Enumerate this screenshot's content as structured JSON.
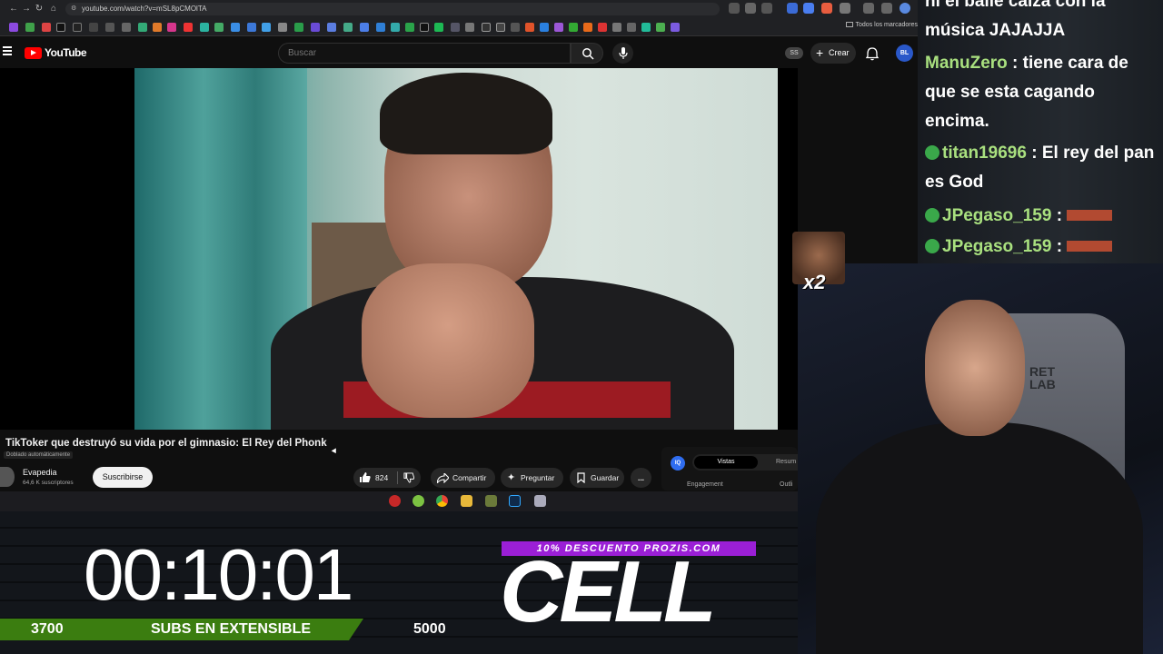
{
  "browser": {
    "url": "youtube.com/watch?v=mSL8pCMOlTA",
    "all_bookmarks": "Todos los marcadores"
  },
  "youtube": {
    "logo_text": "YouTube",
    "search_placeholder": "Buscar",
    "ss_badge": "SS",
    "create_label": "Crear",
    "avatar_text": "BL"
  },
  "video": {
    "title": "TikToker que destruyó su vida por el gimnasio: El Rey del Phonk",
    "dub_label": "Doblado automáticamente",
    "channel_name": "Evapedia",
    "subscribers": "64,6 K suscriptores",
    "subscribe_label": "Suscribirse",
    "likes": "824",
    "share_label": "Compartir",
    "ask_label": "Preguntar",
    "save_label": "Guardar",
    "more_label": "..."
  },
  "side_panel": {
    "logo": "IQ",
    "tab_active": "Vistas",
    "tab_other": "Resum",
    "engagement": "Engagement",
    "outline": "Outli"
  },
  "overlay": {
    "timer": "00:10:01",
    "goal_current": "3700",
    "goal_label": "SUBS EN EXTENSIBLE",
    "goal_target": "5000",
    "goal_progress_fraction": 0.74,
    "promo": "10% DESCUENTO PROZIS.COM",
    "sponsor": "CELL",
    "emote_multiplier": "x2",
    "chair_text": "RET\nLAB"
  },
  "chat": [
    {
      "user": "",
      "text": "ni el baile calza con la música JAJAJJA"
    },
    {
      "user": "ManuZero",
      "text": " : tiene cara de que se esta cagando encima."
    },
    {
      "user": "titan19696",
      "text": " : El rey del pan es God"
    },
    {
      "user": "JPegaso_159",
      "text": " : "
    },
    {
      "user": "JPegaso_159",
      "text": " : "
    }
  ],
  "colors": {
    "yt_red": "#ff0000",
    "goal_green": "#3b7d10",
    "promo_purple": "#9b1fd6",
    "chat_user": "#a9e07f"
  }
}
